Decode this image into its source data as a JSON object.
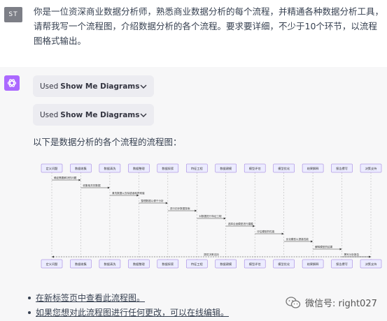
{
  "user": {
    "avatar": "ST",
    "message": "你是一位资深商业数据分析师，熟悉商业数据分析的每个流程，并精通各种数据分析工具，请帮我写一个流程图，介绍数据分析的各个流程。要求要详细，不少于10个环节，以流程图格式输出。"
  },
  "assistant": {
    "plugins": [
      {
        "prefix": "Used",
        "name": "Show Me Diagrams"
      },
      {
        "prefix": "Used",
        "name": "Show Me Diagrams"
      }
    ],
    "intro": "以下是数据分析的各个流程的流程图：",
    "links": [
      {
        "text": "在新标签页中查看此流程图。"
      },
      {
        "text": "如果您想对此流程图进行任何更改，可以在线编辑。"
      }
    ]
  },
  "diagram": {
    "participants": [
      "定义问题",
      "数据收集",
      "数据清洗",
      "数据整理",
      "数据探索",
      "特征工程",
      "数据建模",
      "模型评估",
      "模型优化",
      "结果解释",
      "报告撰写",
      "决策支持"
    ],
    "messages": [
      "确定需要解决的问题",
      "收集相关的数据",
      "清洗数据以去除错误和异常值",
      "整理数据以便于分析",
      "进行初步数据探索",
      "对数据进行特征工程",
      "选择合适模型进行建模",
      "评估模型的性能",
      "优化模型以提高性能",
      "解释模型的结果",
      "撰写分析报告"
    ],
    "return_message": "提供决策支持"
  },
  "watermark": {
    "text": "微信号: right027"
  },
  "colors": {
    "bot_avatar": "#ab68ff",
    "user_avatar": "#7d7f87",
    "assistant_bg": "#f7f7f8",
    "pill_bg": "#ececf1",
    "participant_fill": "#ececff",
    "participant_border": "#9370db"
  }
}
